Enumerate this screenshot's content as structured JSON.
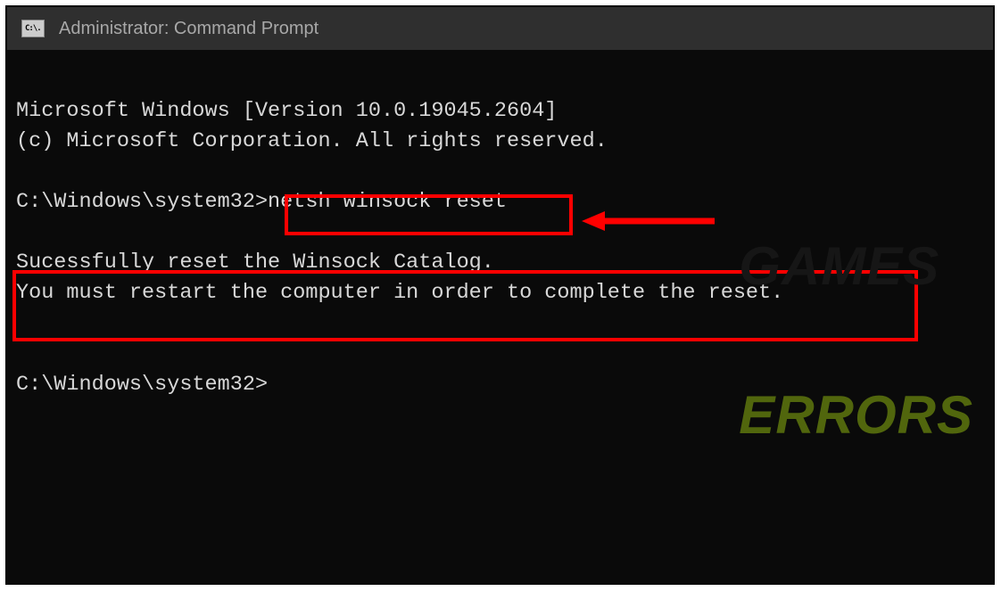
{
  "window": {
    "title": "Administrator: Command Prompt",
    "icon_text": "C:\\."
  },
  "terminal": {
    "version_line": "Microsoft Windows [Version 10.0.19045.2604]",
    "copyright_line": "(c) Microsoft Corporation. All rights reserved.",
    "prompt1_path": "C:\\Windows\\system32>",
    "command": "netsh winsock reset",
    "output_line1": "Sucessfully reset the Winsock Catalog.",
    "output_line2": "You must restart the computer in order to complete the reset.",
    "prompt2_path": "C:\\Windows\\system32>"
  },
  "annotations": {
    "highlight_color": "#ff0000"
  },
  "watermark": {
    "line1": "GAMES",
    "line2": "ERRORS"
  }
}
